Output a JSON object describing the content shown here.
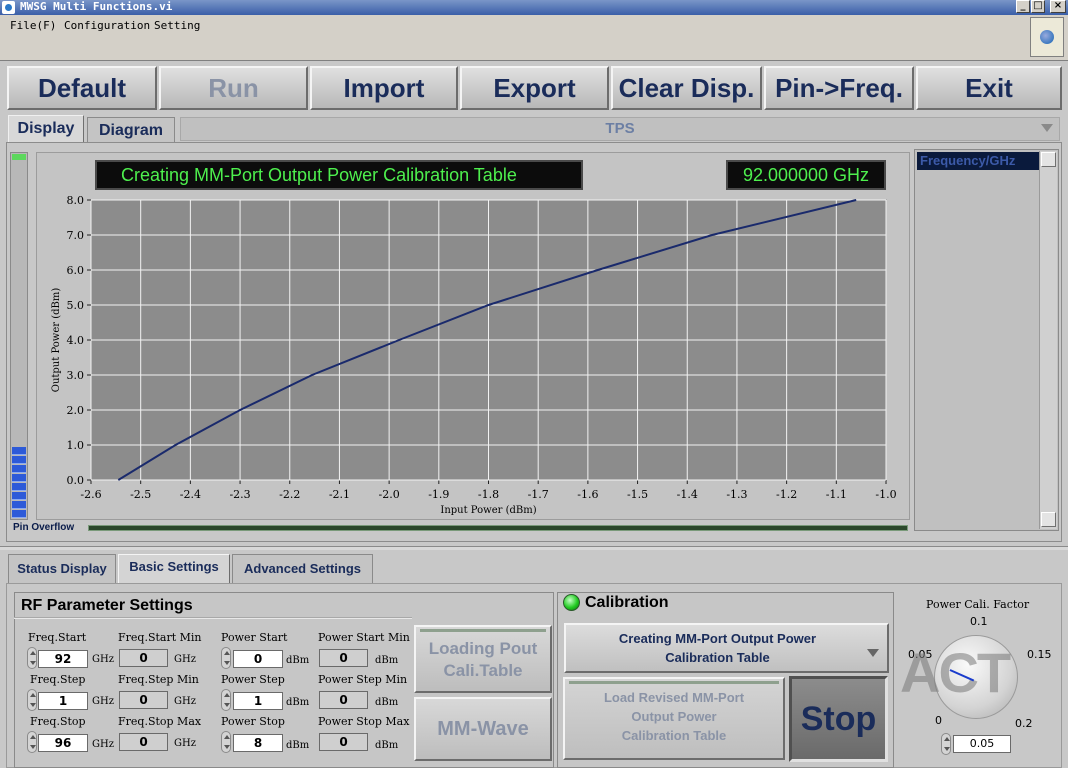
{
  "window": {
    "title": "MWSG Multi Functions.vi",
    "min": "_",
    "max": "□",
    "close": "×"
  },
  "menu": [
    "File(F)",
    "Configuration",
    "Setting"
  ],
  "toolbar": {
    "default": "Default",
    "run": "Run",
    "import": "Import",
    "export": "Export",
    "clear": "Clear Disp.",
    "pinfreq": "Pin->Freq.",
    "exit": "Exit"
  },
  "tabs": {
    "display": "Display",
    "diagram": "Diagram",
    "tps": "TPS"
  },
  "display": {
    "status": "Creating MM-Port Output Power Calibration Table",
    "frequency": "92.000000 GHz",
    "pin_overflow": "Pin Overflow",
    "list_header": "Frequency/GHz"
  },
  "chart_data": {
    "type": "line",
    "xlabel": "Input Power (dBm)",
    "ylabel": "Output Power (dBm)",
    "xlim": [
      -2.6,
      -1.0
    ],
    "ylim": [
      0.0,
      8.0
    ],
    "xticks": [
      "-2.6",
      "-2.5",
      "-2.4",
      "-2.3",
      "-2.2",
      "-2.1",
      "-2.0",
      "-1.9",
      "-1.8",
      "-1.7",
      "-1.6",
      "-1.5",
      "-1.4",
      "-1.3",
      "-1.2",
      "-1.1",
      "-1.0"
    ],
    "yticks": [
      "0.0",
      "1.0",
      "2.0",
      "3.0",
      "4.0",
      "5.0",
      "6.0",
      "7.0",
      "8.0"
    ],
    "grid": true,
    "series": [
      {
        "color": "#1a2a6c",
        "x": [
          -2.545,
          -2.43,
          -2.3,
          -2.155,
          -1.98,
          -1.8,
          -1.58,
          -1.35,
          -1.06
        ],
        "y": [
          0,
          1,
          2,
          3,
          4,
          5,
          6,
          7,
          8
        ]
      }
    ]
  },
  "bottom_tabs": {
    "status": "Status Display",
    "basic": "Basic Settings",
    "advanced": "Advanced Settings"
  },
  "rf": {
    "title": "RF Parameter Settings",
    "fields": [
      {
        "label": "Freq.Start",
        "value": "92",
        "unit": "GHz"
      },
      {
        "label": "Freq.Start Min",
        "value": "0",
        "unit": "GHz"
      },
      {
        "label": "Power Start",
        "value": "0",
        "unit": "dBm"
      },
      {
        "label": "Power Start Min",
        "value": "0",
        "unit": "dBm"
      },
      {
        "label": "Freq.Step",
        "value": "1",
        "unit": "GHz"
      },
      {
        "label": "Freq.Step Min",
        "value": "0",
        "unit": "GHz"
      },
      {
        "label": "Power Step",
        "value": "1",
        "unit": "dBm"
      },
      {
        "label": "Power Step Min",
        "value": "0",
        "unit": "dBm"
      },
      {
        "label": "Freq.Stop",
        "value": "96",
        "unit": "GHz"
      },
      {
        "label": "Freq.Stop  Max",
        "value": "0",
        "unit": "GHz"
      },
      {
        "label": "Power Stop",
        "value": "8",
        "unit": "dBm"
      },
      {
        "label": "Power Stop Max",
        "value": "0",
        "unit": "dBm"
      }
    ],
    "loading_btn": [
      "Loading Pout",
      "Cali.Table"
    ],
    "mmwave_btn": "MM-Wave"
  },
  "calibration": {
    "title": "Calibration",
    "mode": [
      "Creating MM-Port Output Power",
      "Calibration Table"
    ],
    "load_btn": [
      "Load Revised MM-Port",
      "Output Power",
      "Calibration Table"
    ],
    "stop": "Stop"
  },
  "knob": {
    "title": "Power Cali. Factor",
    "ticks": [
      "0",
      "0.05",
      "0.1",
      "0.15",
      "0.2"
    ],
    "value": "0.05",
    "logo": "ACT"
  }
}
